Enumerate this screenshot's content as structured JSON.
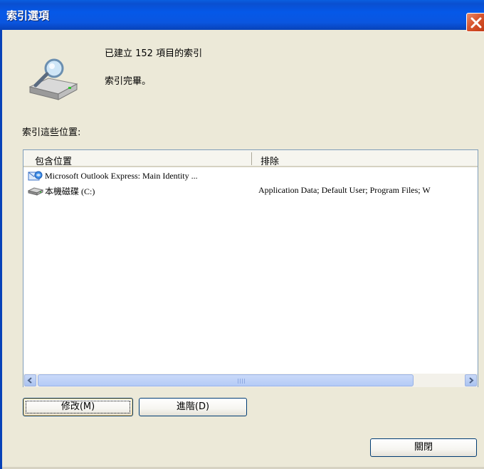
{
  "window": {
    "title": "索引選項"
  },
  "status": {
    "items_indexed": "已建立 152 項目的索引",
    "state": "索引完畢。"
  },
  "locations": {
    "label": "索引這些位置:",
    "columns": {
      "included": "包含位置",
      "excluded": "排除"
    },
    "rows": [
      {
        "name": "Microsoft Outlook Express: Main Identity ...",
        "excluded": "",
        "icon": "outlook-express-icon"
      },
      {
        "name": "本機磁碟 (C:)",
        "excluded": "Application Data; Default User; Program Files; W",
        "icon": "local-disk-icon"
      }
    ]
  },
  "buttons": {
    "modify": "修改(M)",
    "advanced": "進階(D)",
    "close": "關閉"
  },
  "colors": {
    "titlebar": "#0a56e0",
    "dialog_background": "#ece9d8",
    "close_button": "#d8552e"
  }
}
